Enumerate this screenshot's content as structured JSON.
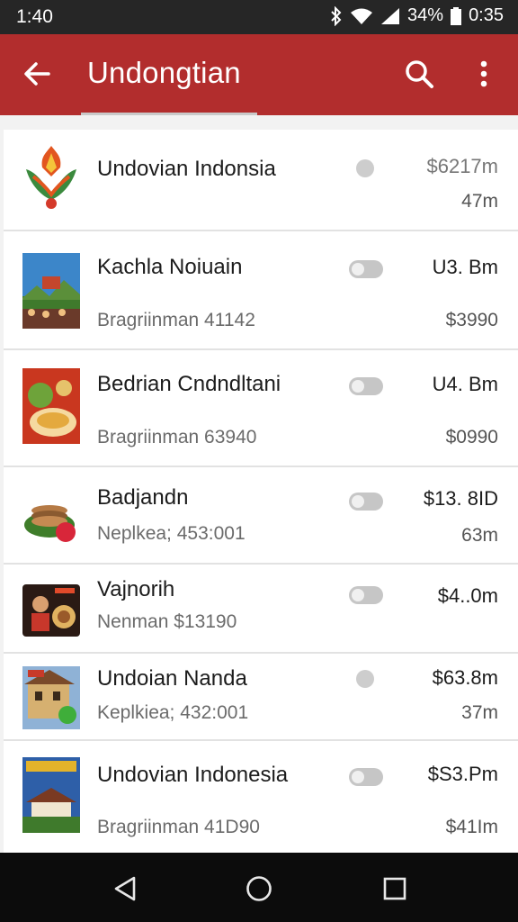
{
  "status_bar": {
    "time": "1:40",
    "battery_text": "34%",
    "clock_right": "0:35",
    "icons": [
      "bluetooth-icon",
      "wifi-icon",
      "signal-icon",
      "battery-icon"
    ]
  },
  "app_bar": {
    "title": "Undongtian",
    "color": "#b22d2d",
    "icons": [
      "back-arrow-icon",
      "search-icon",
      "more-vert-icon"
    ]
  },
  "list": {
    "items": [
      {
        "title": "Undovian Indonsia",
        "subtitle": "",
        "value1": "$6217m",
        "value2": "47m",
        "control": "dot"
      },
      {
        "title": "Kachla Noiuain",
        "subtitle": "Bragriinman 41142",
        "value1": "U3. Bm",
        "value2": "$3990",
        "control": "toggle"
      },
      {
        "title": "Bedrian Cndndltani",
        "subtitle": "Bragriinman 63940",
        "value1": "U4. Bm",
        "value2": "$0990",
        "control": "toggle"
      },
      {
        "title": "Badjandn",
        "subtitle": "Neplkea; 453:001",
        "value1": "$13. 8ID",
        "value2": "63m",
        "control": "toggle"
      },
      {
        "title": "Vajnorih",
        "subtitle": "Nenman $13190",
        "value1": "$4..0m",
        "value2": "",
        "control": "toggle"
      },
      {
        "title": "Undoian Nanda",
        "subtitle": "Keplkiea; 432:001",
        "value1": "$63.8m",
        "value2": "37m",
        "control": "dot"
      },
      {
        "title": "Undovian Indonesia",
        "subtitle": "Bragriinman 41D90",
        "value1": "$S3.Pm",
        "value2": "$41Im",
        "control": "toggle"
      }
    ]
  },
  "nav_bar": {
    "icons": [
      "back-triangle-icon",
      "home-circle-icon",
      "recents-square-icon"
    ]
  }
}
